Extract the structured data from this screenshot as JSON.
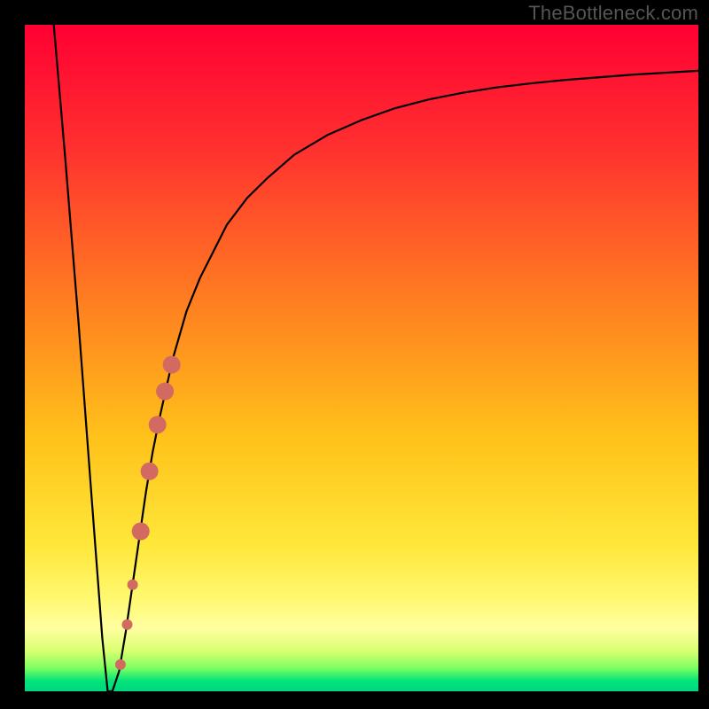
{
  "watermark": "TheBottleneck.com",
  "chart_data": {
    "type": "line",
    "title": "",
    "xlabel": "",
    "ylabel": "",
    "xlim": [
      0,
      100
    ],
    "ylim": [
      0,
      100
    ],
    "grid": false,
    "legend": false,
    "background_gradient": {
      "stops": [
        {
          "offset": 0.0,
          "color": "#ff0033"
        },
        {
          "offset": 0.18,
          "color": "#ff2f2f"
        },
        {
          "offset": 0.45,
          "color": "#ff8a1f"
        },
        {
          "offset": 0.62,
          "color": "#ffc21a"
        },
        {
          "offset": 0.78,
          "color": "#ffe73a"
        },
        {
          "offset": 0.86,
          "color": "#fff870"
        },
        {
          "offset": 0.905,
          "color": "#ffffa0"
        },
        {
          "offset": 0.94,
          "color": "#d8ff70"
        },
        {
          "offset": 0.965,
          "color": "#7dff60"
        },
        {
          "offset": 0.985,
          "color": "#00e37a"
        },
        {
          "offset": 1.0,
          "color": "#00d780"
        }
      ]
    },
    "series": [
      {
        "name": "bottleneck-curve",
        "x": [
          4.3,
          6,
          8,
          10,
          11.5,
          12.3,
          13,
          14,
          15,
          16,
          17,
          18,
          19,
          20,
          22,
          24,
          26,
          28,
          30,
          33,
          36,
          40,
          45,
          50,
          55,
          60,
          65,
          70,
          75,
          80,
          85,
          90,
          95,
          100
        ],
        "y": [
          100,
          80,
          55,
          28,
          8,
          0,
          0,
          3,
          9,
          16,
          23,
          30,
          36,
          41,
          50,
          57,
          62,
          66,
          70,
          74,
          77,
          80.5,
          83.5,
          85.7,
          87.5,
          88.8,
          89.8,
          90.6,
          91.2,
          91.7,
          92.1,
          92.5,
          92.8,
          93.1
        ]
      }
    ],
    "highlight_segment": {
      "name": "highlight-beads",
      "color": "#d36a62",
      "points": [
        {
          "x": 14.2,
          "y": 4,
          "r": 6
        },
        {
          "x": 15.2,
          "y": 10,
          "r": 6
        },
        {
          "x": 16.0,
          "y": 16,
          "r": 6
        },
        {
          "x": 17.2,
          "y": 24,
          "r": 10
        },
        {
          "x": 18.5,
          "y": 33,
          "r": 10
        },
        {
          "x": 19.7,
          "y": 40,
          "r": 10
        },
        {
          "x": 20.8,
          "y": 45,
          "r": 10
        },
        {
          "x": 21.8,
          "y": 49,
          "r": 10
        }
      ]
    }
  }
}
